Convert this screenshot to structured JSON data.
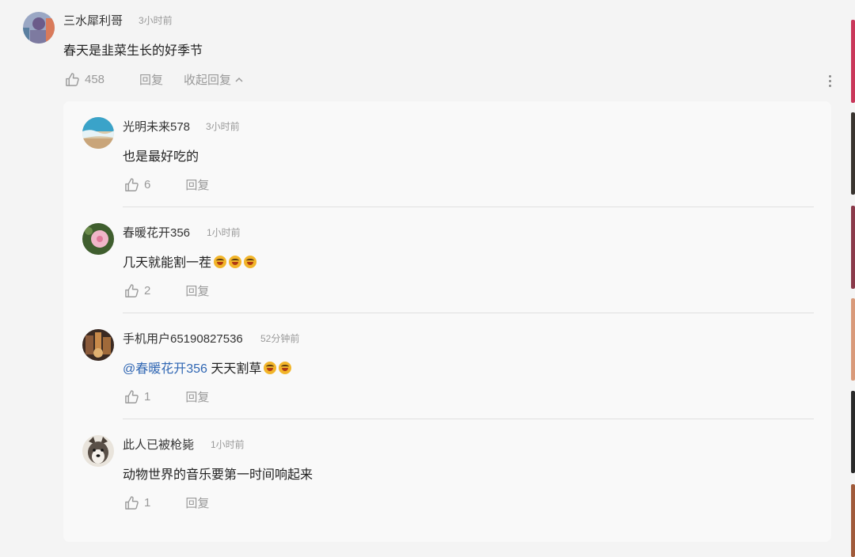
{
  "main_comment": {
    "author": "三水犀利哥",
    "time": "3小时前",
    "text": "春天是韭菜生长的好季节",
    "likes": "458",
    "reply_label": "回复",
    "collapse_label": "收起回复"
  },
  "replies": [
    {
      "author": "光明未来578",
      "time": "3小时前",
      "text": "也是最好吃的",
      "likes": "6",
      "reply_label": "回复"
    },
    {
      "author": "春暖花开356",
      "time": "1小时前",
      "text": "几天就能割一茬",
      "likes": "2",
      "reply_label": "回复"
    },
    {
      "author": "手机用户65190827536",
      "time": "52分钟前",
      "mention": "@春暖花开356",
      "text": "天天割草",
      "likes": "1",
      "reply_label": "回复"
    },
    {
      "author": "此人已被枪毙",
      "time": "1小时前",
      "text": "动物世界的音乐要第一时间响起来",
      "likes": "1",
      "reply_label": "回复"
    }
  ],
  "colors": {
    "background": "#f4f4f4",
    "panel": "#f9f9f9",
    "mention": "#2f66b3",
    "meta": "#999999"
  }
}
